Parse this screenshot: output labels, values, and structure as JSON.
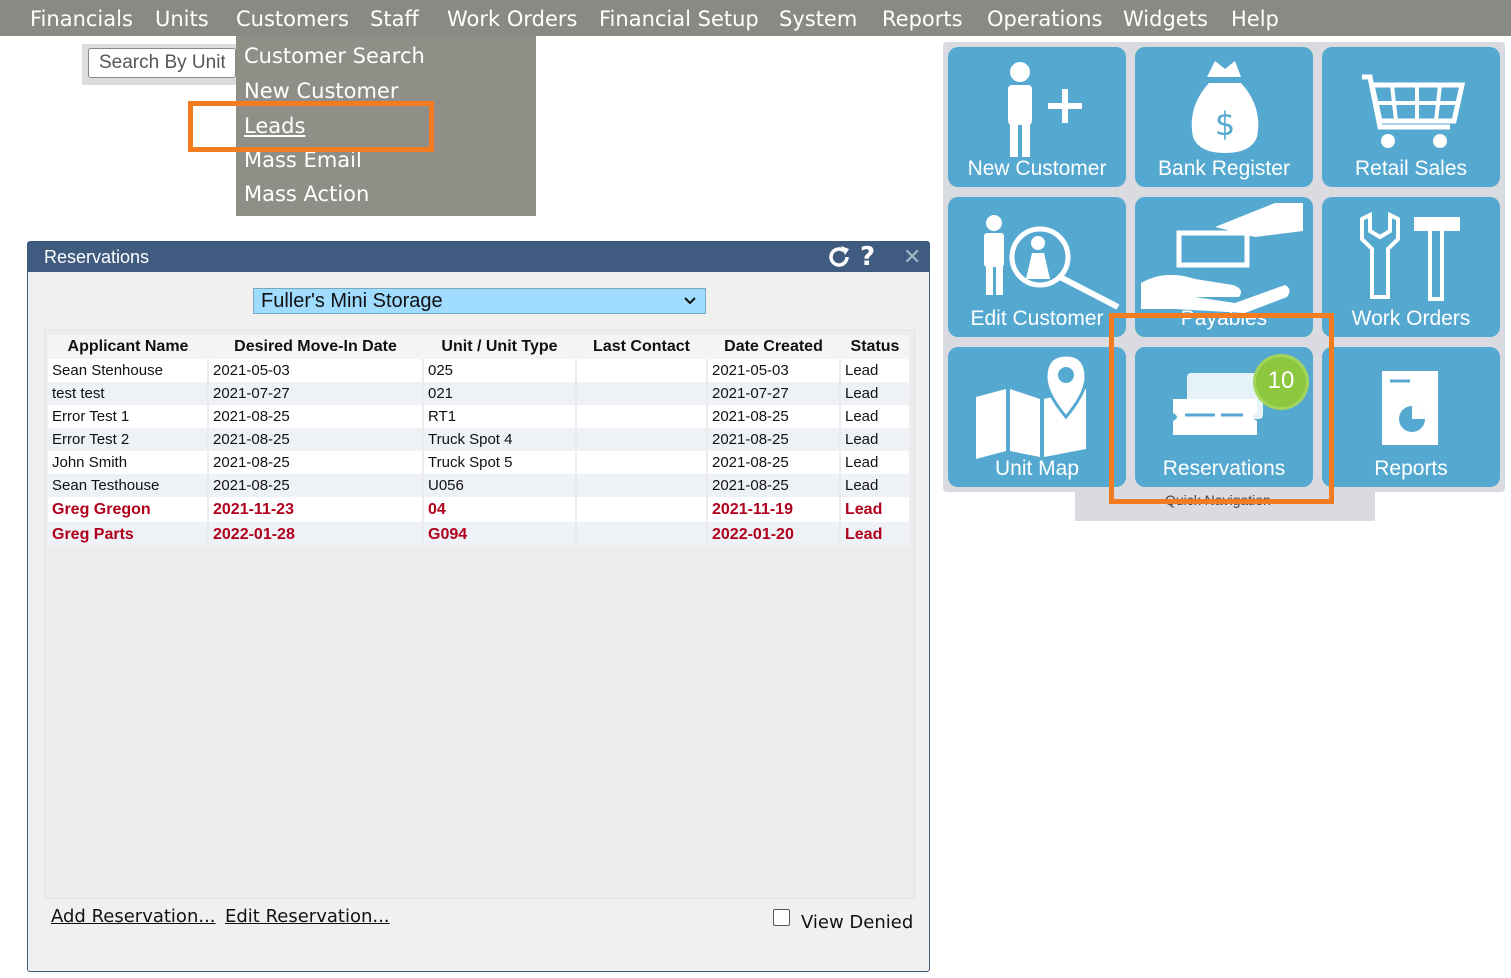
{
  "menu": {
    "items": [
      "Financials",
      "Units",
      "Customers",
      "Staff",
      "Work Orders",
      "Financial Setup",
      "System",
      "Reports",
      "Operations",
      "Widgets",
      "Help"
    ]
  },
  "customers_dropdown": {
    "items": [
      "Customer Search",
      "New Customer",
      "Leads",
      "Mass Email",
      "Mass Action"
    ]
  },
  "search": {
    "placeholder": "Search By Unit"
  },
  "reservations": {
    "title": "Reservations",
    "facility": "Fuller's Mini Storage",
    "columns": [
      "Applicant Name",
      "Desired Move-In Date",
      "Unit / Unit Type",
      "Last Contact",
      "Date Created",
      "Status"
    ],
    "rows": [
      [
        "Sean Stenhouse",
        "2021-05-03",
        "025",
        "",
        "2021-05-03",
        "Lead"
      ],
      [
        "test test",
        "2021-07-27",
        "021",
        "",
        "2021-07-27",
        "Lead"
      ],
      [
        "Error Test 1",
        "2021-08-25",
        "RT1",
        "",
        "2021-08-25",
        "Lead"
      ],
      [
        "Error Test 2",
        "2021-08-25",
        "Truck Spot 4",
        "",
        "2021-08-25",
        "Lead"
      ],
      [
        "John Smith",
        "2021-08-25",
        "Truck Spot 5",
        "",
        "2021-08-25",
        "Lead"
      ],
      [
        "Sean Testhouse",
        "2021-08-25",
        "U056",
        "",
        "2021-08-25",
        "Lead"
      ],
      [
        "Greg Gregon",
        "2021-11-23",
        "04",
        "",
        "2021-11-19",
        "Lead"
      ],
      [
        "Greg Parts",
        "2022-01-28",
        "G094",
        "",
        "2022-01-20",
        "Lead"
      ]
    ],
    "add_link": "Add Reservation...",
    "edit_link": "Edit Reservation...",
    "view_denied": "View Denied"
  },
  "quick_nav": {
    "label": "Quick Navigation",
    "tiles": [
      "New Customer",
      "Bank Register",
      "Retail Sales",
      "Edit Customer",
      "Payables",
      "Work Orders",
      "Unit Map",
      "Reservations",
      "Reports"
    ],
    "reservations_badge": "10"
  },
  "colors": {
    "accent_highlight": "#f47b20",
    "tile": "#55a9d0",
    "header": "#3f5b7f",
    "lead_red": "#b0001c",
    "badge": "#8dc63f"
  }
}
